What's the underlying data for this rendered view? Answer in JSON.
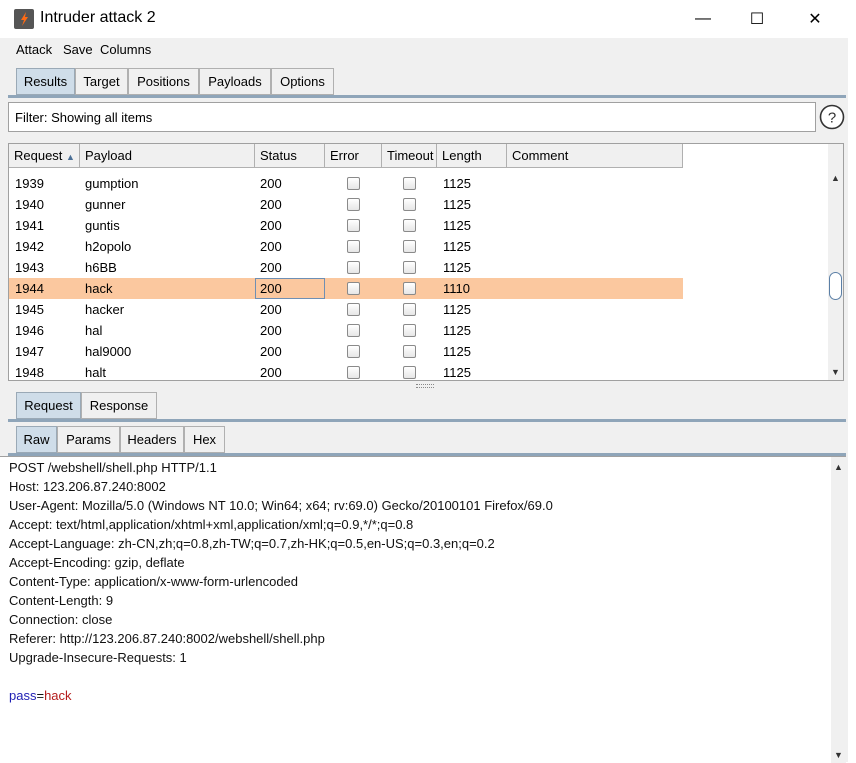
{
  "window": {
    "title": "Intruder attack 2",
    "controls": {
      "minimize": "—",
      "maximize": "☐",
      "close": "✕"
    }
  },
  "menu": [
    "Attack",
    "Save",
    "Columns"
  ],
  "top_tabs": [
    {
      "label": "Results",
      "active": true
    },
    {
      "label": "Target",
      "active": false
    },
    {
      "label": "Positions",
      "active": false
    },
    {
      "label": "Payloads",
      "active": false
    },
    {
      "label": "Options",
      "active": false
    }
  ],
  "filter": {
    "text": "Filter: Showing all items",
    "help_icon": "question-circle-icon"
  },
  "table": {
    "columns": [
      "Request",
      "Payload",
      "Status",
      "Error",
      "Timeout",
      "Length",
      "Comment"
    ],
    "sort_indicator": "▲",
    "rows": [
      {
        "request": "1939",
        "payload": "gumption",
        "status": "200",
        "error": false,
        "timeout": false,
        "length": "1125",
        "comment": "",
        "selected": false
      },
      {
        "request": "1940",
        "payload": "gunner",
        "status": "200",
        "error": false,
        "timeout": false,
        "length": "1125",
        "comment": "",
        "selected": false
      },
      {
        "request": "1941",
        "payload": "guntis",
        "status": "200",
        "error": false,
        "timeout": false,
        "length": "1125",
        "comment": "",
        "selected": false
      },
      {
        "request": "1942",
        "payload": "h2opolo",
        "status": "200",
        "error": false,
        "timeout": false,
        "length": "1125",
        "comment": "",
        "selected": false
      },
      {
        "request": "1943",
        "payload": "h6BB",
        "status": "200",
        "error": false,
        "timeout": false,
        "length": "1125",
        "comment": "",
        "selected": false
      },
      {
        "request": "1944",
        "payload": "hack",
        "status": "200",
        "error": false,
        "timeout": false,
        "length": "1110",
        "comment": "",
        "selected": true
      },
      {
        "request": "1945",
        "payload": "hacker",
        "status": "200",
        "error": false,
        "timeout": false,
        "length": "1125",
        "comment": "",
        "selected": false
      },
      {
        "request": "1946",
        "payload": "hal",
        "status": "200",
        "error": false,
        "timeout": false,
        "length": "1125",
        "comment": "",
        "selected": false
      },
      {
        "request": "1947",
        "payload": "hal9000",
        "status": "200",
        "error": false,
        "timeout": false,
        "length": "1125",
        "comment": "",
        "selected": false
      },
      {
        "request": "1948",
        "payload": "halt",
        "status": "200",
        "error": false,
        "timeout": false,
        "length": "1125",
        "comment": "",
        "selected": false
      }
    ]
  },
  "detail_tabs": [
    {
      "label": "Request",
      "active": true
    },
    {
      "label": "Response",
      "active": false
    }
  ],
  "view_tabs": [
    {
      "label": "Raw",
      "active": true
    },
    {
      "label": "Params",
      "active": false
    },
    {
      "label": "Headers",
      "active": false
    },
    {
      "label": "Hex",
      "active": false
    }
  ],
  "request": {
    "lines": [
      "POST /webshell/shell.php HTTP/1.1",
      "Host: 123.206.87.240:8002",
      "User-Agent: Mozilla/5.0 (Windows NT 10.0; Win64; x64; rv:69.0) Gecko/20100101 Firefox/69.0",
      "Accept: text/html,application/xhtml+xml,application/xml;q=0.9,*/*;q=0.8",
      "Accept-Language: zh-CN,zh;q=0.8,zh-TW;q=0.7,zh-HK;q=0.5,en-US;q=0.3,en;q=0.2",
      "Accept-Encoding: gzip, deflate",
      "Content-Type: application/x-www-form-urlencoded",
      "Content-Length: 9",
      "Connection: close",
      "Referer: http://123.206.87.240:8002/webshell/shell.php",
      "Upgrade-Insecure-Requests: 1"
    ],
    "body_param": {
      "name": "pass",
      "eq": "=",
      "value": "hack"
    }
  }
}
